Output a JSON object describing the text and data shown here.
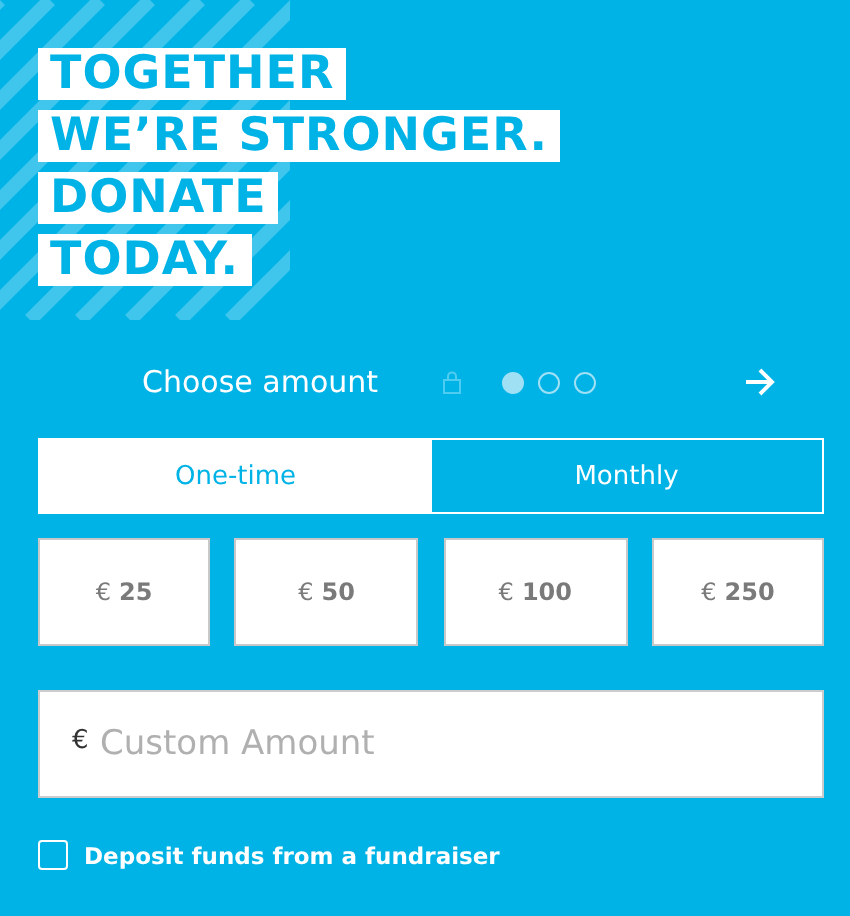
{
  "headline": [
    "TOGETHER",
    "WE’RE STRONGER.",
    "DONATE",
    "TODAY."
  ],
  "step_header": {
    "title": "Choose amount",
    "steps": [
      {
        "selected": true
      },
      {
        "selected": false
      },
      {
        "selected": false
      }
    ]
  },
  "frequency_tabs": [
    {
      "label": "One-time",
      "selected": true
    },
    {
      "label": "Monthly",
      "selected": false
    }
  ],
  "amounts": [
    {
      "currency": "€",
      "value": "25"
    },
    {
      "currency": "€",
      "value": "50"
    },
    {
      "currency": "€",
      "value": "100"
    },
    {
      "currency": "€",
      "value": "250"
    }
  ],
  "custom_amount": {
    "currency": "€",
    "placeholder": "Custom Amount"
  },
  "fundraiser_option": {
    "label": "Deposit funds from a fundraiser",
    "checked": false
  }
}
